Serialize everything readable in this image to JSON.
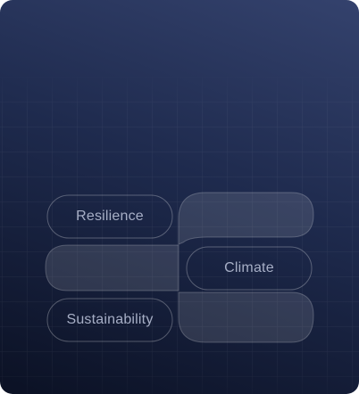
{
  "tags": [
    {
      "label": "Resilience"
    },
    {
      "label": "Climate"
    },
    {
      "label": "Sustainability"
    }
  ]
}
